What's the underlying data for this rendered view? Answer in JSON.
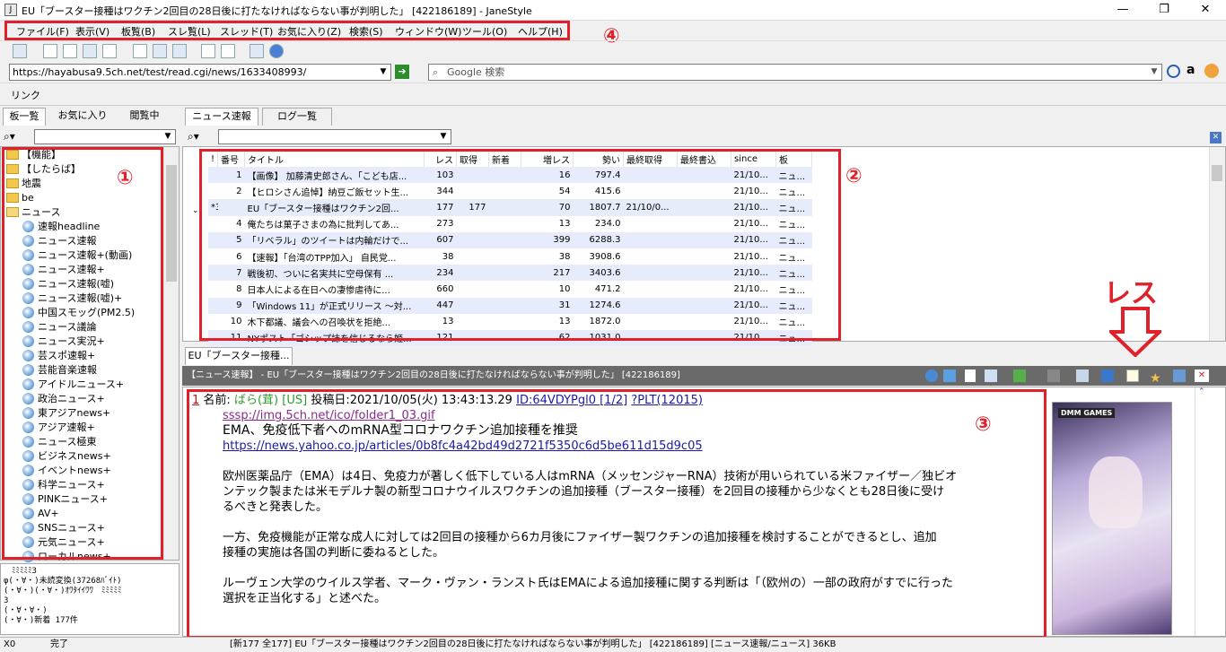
{
  "window": {
    "title": "EU「ブースター接種はワクチン2回目の28日後に打たなければならない事が判明した」 [422186189] - JaneStyle",
    "minimize": "—",
    "maximize": "❐",
    "close": "✕"
  },
  "menu": [
    "ファイル(F)",
    "表示(V)",
    "板覧(B)",
    "スレ覧(L)",
    "スレッド(T)",
    "お気に入り(Z)",
    "検索(S)",
    "ウィンドウ(W)",
    "ツール(O)",
    "ヘルプ(H)"
  ],
  "address": {
    "url": "https://hayabusa9.5ch.net/test/read.cgi/news/1633408993/",
    "search_placeholder": "Google 検索"
  },
  "linkbar": {
    "label": "リンク"
  },
  "left_tabs": [
    "板一覧",
    "お気に入り",
    "閲覧中"
  ],
  "tree": {
    "folders": [
      "【機能】",
      "【したらば】",
      "地震",
      "be",
      "ニュース"
    ],
    "boards": [
      "速報headline",
      "ニュース速報",
      "ニュース速報+(動画)",
      "ニュース速報+",
      "ニュース速報(嘘)",
      "ニュース速報(嘘)+",
      "中国スモッグ(PM2.5)",
      "ニュース議論",
      "ニュース実況+",
      "芸スポ速報+",
      "芸能音楽速報",
      "アイドルニュース+",
      "政治ニュース+",
      "東アジアnews+",
      "アジア速報+",
      "ニュース極東",
      "ビジネスnews+",
      "イベントnews+",
      "科学ニュース+",
      "PINKニュース+",
      "AV+",
      "SNSニュース+",
      "元気ニュース+",
      "ローカルnews+"
    ]
  },
  "log": [
    "　ﾐﾐﾐﾐﾐ3",
    "φ(・∀・)未読変換(37268ﾊﾞｲﾄ)",
    "(・∀・)(・∀・)ｵﾜﾀｲｲﾜﾜ　ﾐﾐﾐﾐﾐ",
    "3",
    "(・∀・∀・)",
    "(・∀・)新着 177件"
  ],
  "thread_tabs": [
    "ニュース速報",
    "ログ一覧"
  ],
  "threadlist": {
    "columns": [
      "!",
      "番号",
      "タイトル",
      "レス",
      "取得",
      "新着",
      "増レス",
      "勢い",
      "最終取得",
      "最終書込",
      "since",
      "板"
    ],
    "rows": [
      [
        "",
        "1",
        "【画像】 加藤清史郎さん、「こども店...",
        "103",
        "",
        "",
        "16",
        "797.4",
        "",
        "",
        "21/10...",
        "ニュ..."
      ],
      [
        "",
        "2",
        "【ヒロシさん追悼】納豆ご飯セット生...",
        "344",
        "",
        "",
        "54",
        "415.6",
        "",
        "",
        "21/10...",
        "ニュ..."
      ],
      [
        "*3",
        "",
        "EU「ブースター接種はワクチン2回...",
        "177",
        "177",
        "",
        "70",
        "1807.7",
        "21/10/0...",
        "",
        "21/10...",
        "ニュ..."
      ],
      [
        "",
        "4",
        "俺たちは菓子さまの為に批判してあ...",
        "273",
        "",
        "",
        "13",
        "234.0",
        "",
        "",
        "21/10...",
        "ニュ..."
      ],
      [
        "",
        "5",
        "「リベラル」のツイートは内輪だけで...",
        "607",
        "",
        "",
        "399",
        "6288.3",
        "",
        "",
        "21/10...",
        "ニュ..."
      ],
      [
        "",
        "6",
        "【速報】「台湾のTPP加入」 自民党...",
        "38",
        "",
        "",
        "38",
        "3908.6",
        "",
        "",
        "21/10...",
        "ニュ..."
      ],
      [
        "",
        "7",
        "戦後初、ついに名実共に空母保有 ...",
        "234",
        "",
        "",
        "217",
        "3403.6",
        "",
        "",
        "21/10...",
        "ニュ..."
      ],
      [
        "",
        "8",
        "日本人による在日への凄惨虐待に...",
        "660",
        "",
        "",
        "10",
        "471.2",
        "",
        "",
        "21/10...",
        "ニュ..."
      ],
      [
        "",
        "9",
        "「Windows 11」が正式リリース ～対...",
        "447",
        "",
        "",
        "31",
        "1274.6",
        "",
        "",
        "21/10...",
        "ニュ..."
      ],
      [
        "",
        "10",
        "木下都議、議会への召喚状を拒絶...",
        "13",
        "",
        "",
        "13",
        "1872.0",
        "",
        "",
        "21/10...",
        "ニュ..."
      ],
      [
        "",
        "11",
        "NYポスト「ゴシップ誌を信じるなら姫...",
        "121",
        "",
        "",
        "62",
        "1031.0",
        "",
        "",
        "21/10...",
        "ニュ..."
      ]
    ]
  },
  "read_tab": "EU「ブースター接種...",
  "read_header": "【ニュース速報】 - EU「ブースター接種はワクチン2回目の28日後に打たなければならない事が判明した」 [422186189]",
  "post": {
    "num": "1",
    "name_label": "名前:",
    "name": "ばら(茸)",
    "flag": "[US]",
    "date": "投稿日:2021/10/05(火) 13:43:13.29",
    "id": "ID:64VDYPgl0 [1/2]",
    "plt": "?PLT(12015)",
    "icon_url": "sssp://img.5ch.net/ico/folder1_03.gif",
    "headline": "EMA、免疫低下者へのmRNA型コロナワクチン追加接種を推奨",
    "article_url": "https://news.yahoo.co.jp/articles/0b8fc4a42bd49d2721f5350c6d5be611d15d9c05",
    "p1a": "欧州医薬品庁（EMA）は4日、免疫力が著しく低下している人はmRNA（メッセンジャーRNA）技術が用いられている米ファイザー／独ビオ",
    "p1b": "ンテック製または米モデルナ製の新型コロナウイルスワクチンの追加接種（ブースター接種）を2回目の接種から少なくとも28日後に受け",
    "p1c": "るべきと発表した。",
    "p2a": "一方、免疫機能が正常な成人に対しては2回目の接種から6カ月後にファイザー製ワクチンの追加接種を検討することができるとし、追加",
    "p2b": "接種の実施は各国の判断に委ねるとした。",
    "p3a": "ルーヴェン大学のウイルス学者、マーク・ヴァン・ランスト氏はEMAによる追加接種に関する判断は「（欧州の）一部の政府がすでに行った",
    "p3b": "選択を正当化する」と述べた。"
  },
  "ad": {
    "brand": "DMM GAMES"
  },
  "annotations": {
    "n1": "①",
    "n2": "②",
    "n3": "③",
    "n4": "④",
    "res": "レス"
  },
  "status": {
    "coord": "X0",
    "state": "完了",
    "info": "[新177 全177] EU「ブースター接種はワクチン2回目の28日後に打たなければならない事が判明した」 [422186189] [ニュース速報/ニュース] 36KB"
  },
  "colors": {
    "annotation_red": "#e0202a",
    "list_stripe": "#e6ecfb",
    "header_gray": "#6a6a6a",
    "name_green": "#2e9a2e"
  }
}
